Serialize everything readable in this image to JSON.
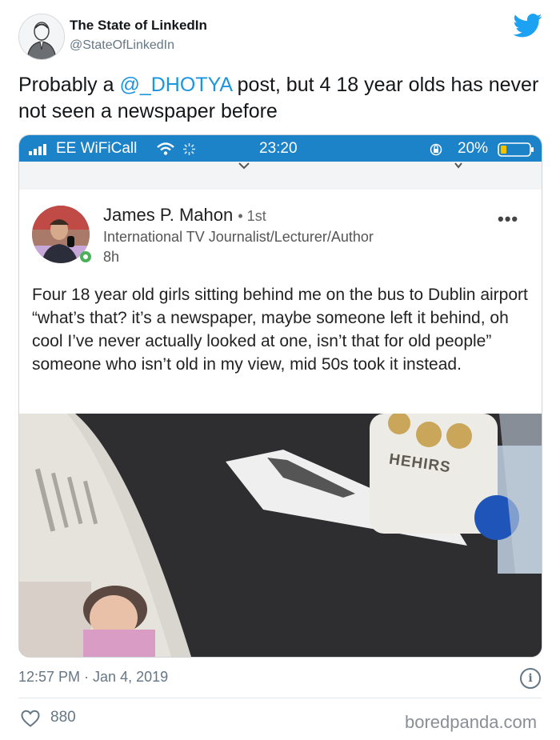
{
  "tweet": {
    "display_name": "The State of LinkedIn",
    "handle": "@StateOfLinkedIn",
    "text_before": "Probably a ",
    "mention": "@_DHOTYA",
    "text_after": " post, but 4 18 year olds has never not seen a newspaper before",
    "timestamp": "12:57 PM · Jan 4, 2019",
    "likes": "880",
    "icons": {
      "brand": "twitter-bird-icon",
      "like": "heart-icon",
      "info": "info-icon"
    },
    "colors": {
      "link": "#1b95e0",
      "brand": "#1da1f2",
      "muted": "#657786"
    }
  },
  "screenshot": {
    "status_bar": {
      "carrier": "EE WiFiCall",
      "time": "23:20",
      "battery": "20%",
      "color": "#1d83c9"
    },
    "post": {
      "author": "James P. Mahon",
      "degree": "• 1st",
      "headline": "International TV Journalist/Lecturer/Author",
      "time_ago": "8h",
      "text": "Four 18 year old girls sitting behind me on the bus to Dublin airport “what’s that? it’s a newspaper, maybe someone left it behind, oh cool I’ve never actually looked at one, isn’t that for old people” someone who isn’t old in my view, mid 50s took it instead.",
      "photo_cup_text": "HEHIRS"
    }
  },
  "watermark": "boredpanda.com"
}
